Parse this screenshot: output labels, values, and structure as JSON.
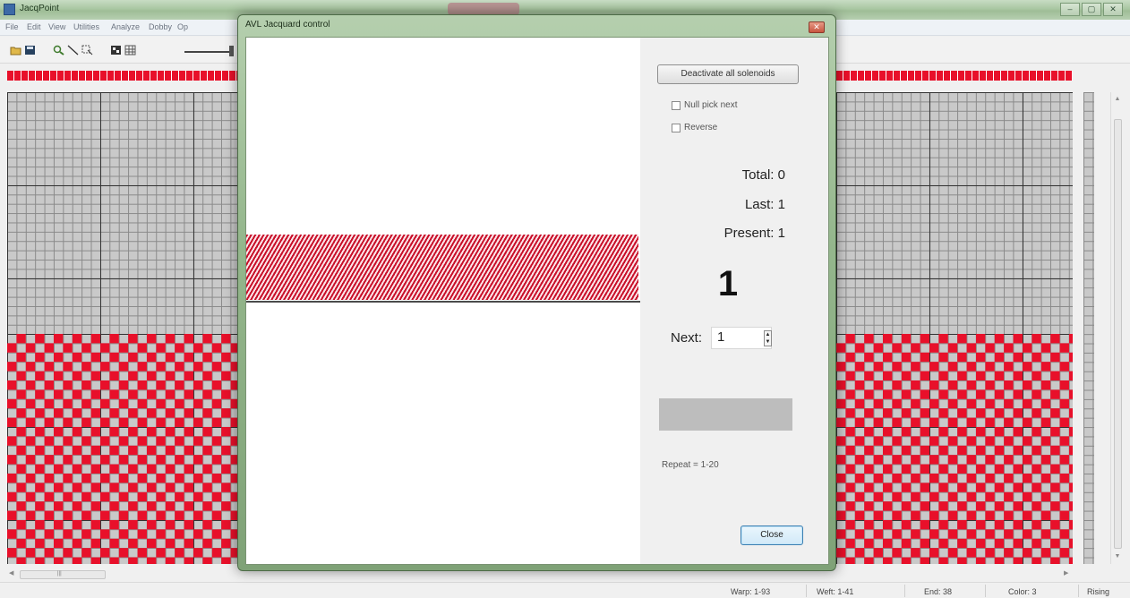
{
  "app": {
    "title": "JacqPoint",
    "window_buttons": [
      "–",
      "▢",
      "✕"
    ]
  },
  "menu": [
    "File",
    "Edit",
    "View",
    "Utilities",
    "Analyze",
    "Dobby",
    "Op"
  ],
  "toolbar": {
    "icons": [
      "open-icon",
      "save-icon",
      "zoom-icon",
      "line-icon",
      "select-icon",
      "fill-icon",
      "grid-icon"
    ]
  },
  "status": {
    "warp": "Warp: 1-93",
    "weft": "Weft: 1-41",
    "end": "End: 38",
    "color": "Color: 3",
    "mode": "Rising"
  },
  "dialog": {
    "title": "AVL Jacquard control",
    "deactivate_label": "Deactivate all solenoids",
    "null_pick_label": "Null pick next",
    "reverse_label": "Reverse",
    "total_label": "Total:",
    "total_value": "0",
    "last_label": "Last:",
    "last_value": "1",
    "present_label": "Present:",
    "present_value": "1",
    "current_pick": "1",
    "next_label": "Next:",
    "next_value": "1",
    "repeat_text": "Repeat = 1-20",
    "close_label": "Close"
  },
  "colors": {
    "accent_red": "#e8102a",
    "grid_gray": "#c9c9c9",
    "dialog_frame": "#95b78d"
  }
}
